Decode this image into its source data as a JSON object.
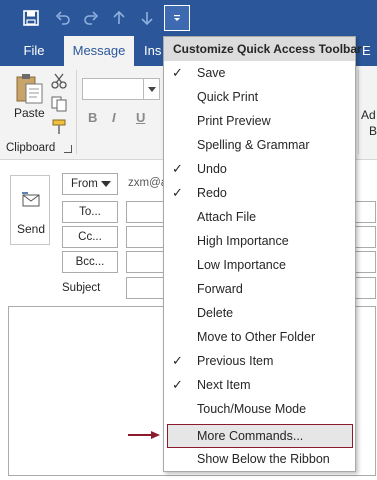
{
  "ribbon_tabs": {
    "file": "File",
    "message": "Message",
    "insert_partial": "Ins",
    "right_partial": "E"
  },
  "ribbon": {
    "paste_label": "Paste",
    "clipboard_label": "Clipboard",
    "bold": "B",
    "italic": "I",
    "underline": "U",
    "right_text1": "Ad",
    "right_text2": "B"
  },
  "compose": {
    "send_label": "Send",
    "from_label": "From",
    "from_address": "zxm@a",
    "to_label": "To...",
    "cc_label": "Cc...",
    "bcc_label": "Bcc...",
    "subject_label": "Subject"
  },
  "menu": {
    "title": "Customize Quick Access Toolbar",
    "items": [
      {
        "label": "Save",
        "checked": true
      },
      {
        "label": "Quick Print",
        "checked": false
      },
      {
        "label": "Print Preview",
        "checked": false
      },
      {
        "label": "Spelling & Grammar",
        "checked": false
      },
      {
        "label": "Undo",
        "checked": true
      },
      {
        "label": "Redo",
        "checked": true
      },
      {
        "label": "Attach File",
        "checked": false
      },
      {
        "label": "High Importance",
        "checked": false
      },
      {
        "label": "Low Importance",
        "checked": false
      },
      {
        "label": "Forward",
        "checked": false
      },
      {
        "label": "Delete",
        "checked": false
      },
      {
        "label": "Move to Other Folder",
        "checked": false
      },
      {
        "label": "Previous Item",
        "checked": true
      },
      {
        "label": "Next Item",
        "checked": true
      },
      {
        "label": "Touch/Mouse Mode",
        "checked": false
      }
    ],
    "more_commands": "More Commands...",
    "show_below": "Show Below the Ribbon",
    "check_glyph": "✓"
  },
  "colors": {
    "title_bar": "#2b579a",
    "highlight_border": "#8b1a2e",
    "arrow": "#8b1a2e"
  },
  "icons": [
    "save-icon",
    "undo-icon",
    "redo-icon",
    "up-arrow-icon",
    "down-arrow-icon",
    "customize-dropdown-icon",
    "paste-icon",
    "cut-icon",
    "copy-icon",
    "format-painter-icon",
    "send-icon",
    "check-icon",
    "annotation-arrow-icon"
  ]
}
